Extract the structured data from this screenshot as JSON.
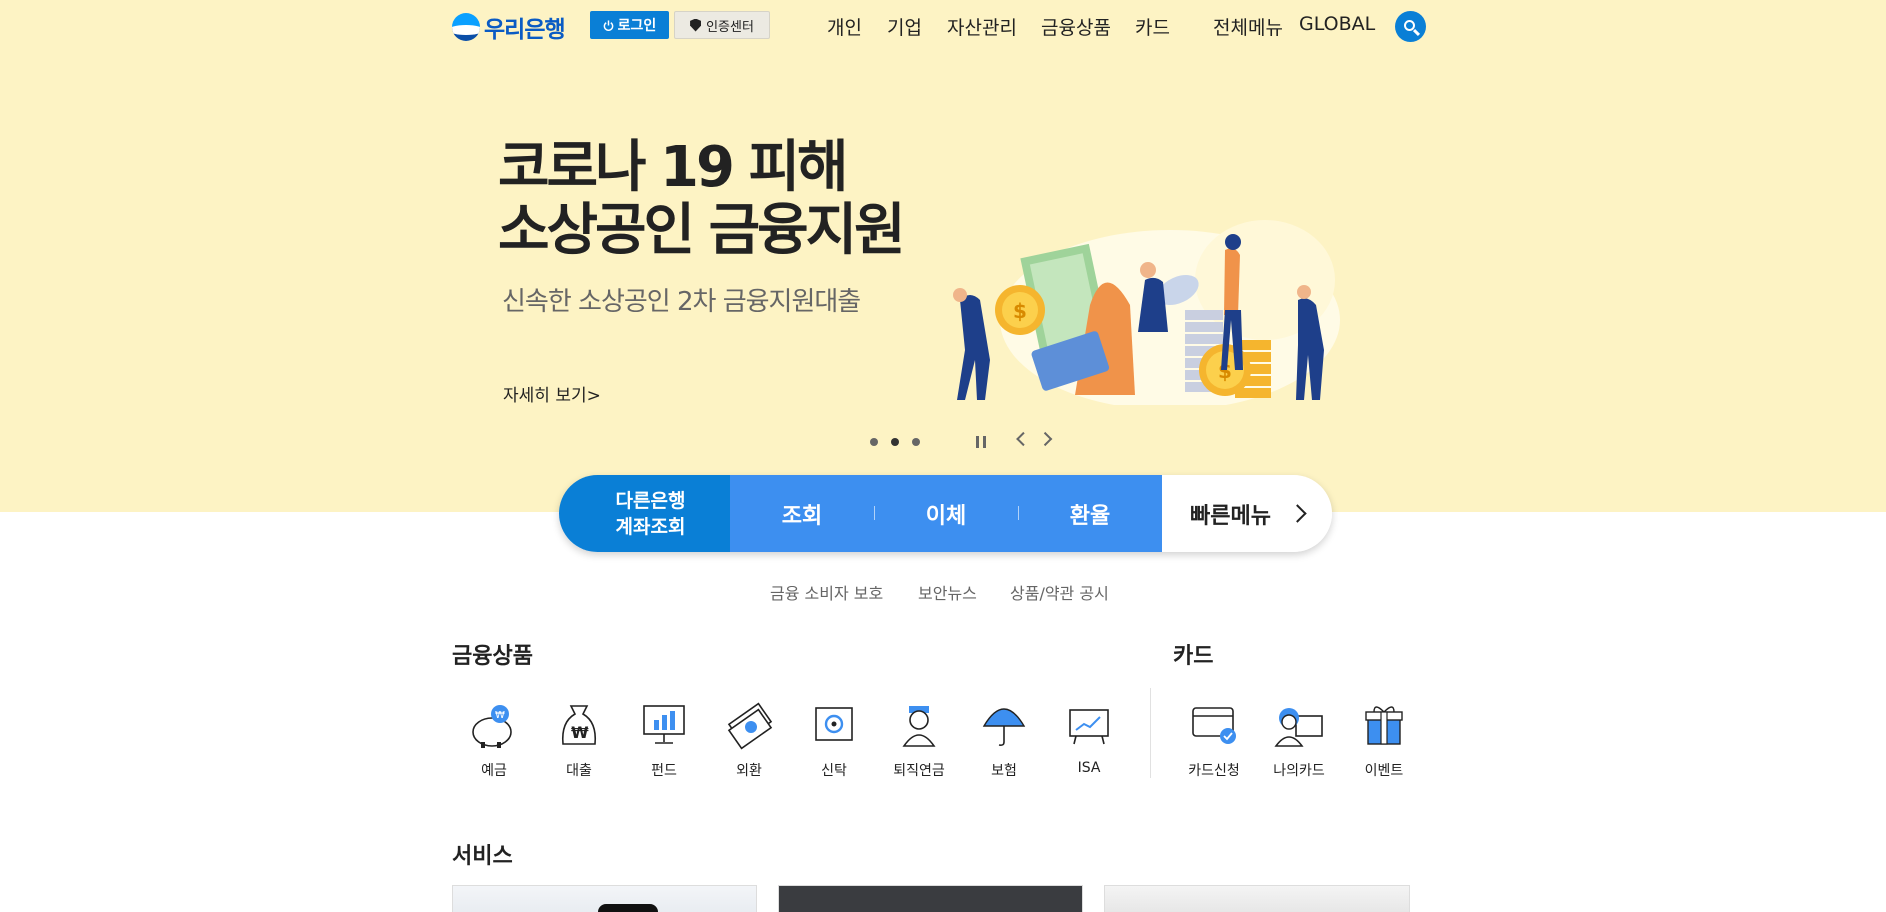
{
  "header": {
    "logo_text": "우리은행",
    "login_label": "로그인",
    "cert_label": "인증센터",
    "nav": [
      "개인",
      "기업",
      "자산관리",
      "금융상품",
      "카드",
      "전체메뉴",
      "GLOBAL"
    ]
  },
  "hero": {
    "title_line1": "코로나 19 피해",
    "title_line2": "소상공인 금융지원",
    "subtitle": "신속한 소상공인 2차 금융지원대출",
    "more_label": "자세히 보기>"
  },
  "quick": {
    "first_line1": "다른은행",
    "first_line2": "계좌조회",
    "items": [
      "조회",
      "이체",
      "환율"
    ],
    "fast_menu": "빠른메뉴"
  },
  "links": [
    "금융 소비자 보호",
    "보안뉴스",
    "상품/약관 공시"
  ],
  "products": {
    "title": "금융상품",
    "items": [
      "예금",
      "대출",
      "펀드",
      "외환",
      "신탁",
      "퇴직연금",
      "보험",
      "ISA"
    ]
  },
  "card": {
    "title": "카드",
    "items": [
      "카드신청",
      "나의카드",
      "이벤트"
    ]
  },
  "services": {
    "title": "서비스"
  },
  "colors": {
    "hero_bg": "#fdf3c4",
    "primary": "#0a7fd6",
    "quick_mid": "#3d8ff0"
  }
}
